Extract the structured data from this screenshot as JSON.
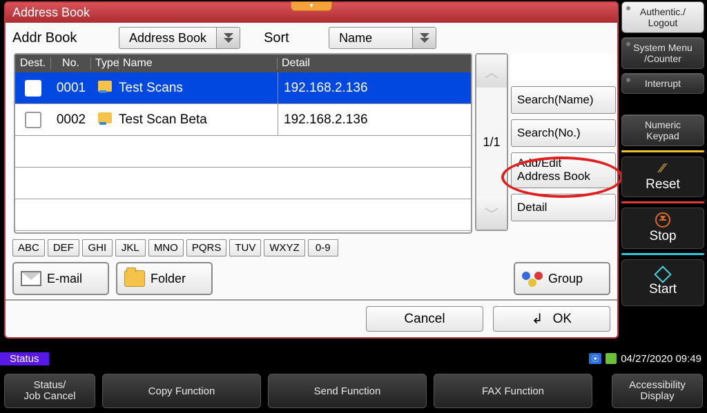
{
  "window_title": "Address Book",
  "toolbar": {
    "addr_label": "Addr Book",
    "addr_select": "Address Book",
    "sort_label": "Sort",
    "sort_select": "Name"
  },
  "columns": {
    "dest": "Dest.",
    "no": "No.",
    "type": "Type",
    "name": "Name",
    "detail": "Detail"
  },
  "rows": [
    {
      "no": "0001",
      "name": "Test Scans",
      "detail": "192.168.2.136",
      "selected": true
    },
    {
      "no": "0002",
      "name": "Test Scan Beta",
      "detail": "192.168.2.136",
      "selected": false
    }
  ],
  "page_info": "1/1",
  "side_buttons": {
    "search_name": "Search(Name)",
    "search_no": "Search(No.)",
    "add_edit": "Add/Edit\nAddress Book",
    "detail": "Detail"
  },
  "alpha": [
    "ABC",
    "DEF",
    "GHI",
    "JKL",
    "MNO",
    "PQRS",
    "TUV",
    "WXYZ",
    "0-9"
  ],
  "big_buttons": {
    "email": "E-mail",
    "folder": "Folder",
    "group": "Group"
  },
  "actions": {
    "cancel": "Cancel",
    "ok": "OK"
  },
  "hw": {
    "auth": "Authentic./\nLogout",
    "system_menu": "System Menu\n/Counter",
    "interrupt": "Interrupt",
    "numeric": "Numeric\nKeypad",
    "reset": "Reset",
    "stop": "Stop",
    "start": "Start"
  },
  "status": {
    "label": "Status",
    "datetime": "04/27/2020  09:49"
  },
  "footer": {
    "status_job": "Status/\nJob Cancel",
    "copy": "Copy Function",
    "send": "Send Function",
    "fax": "FAX Function",
    "access": "Accessibility\nDisplay"
  }
}
